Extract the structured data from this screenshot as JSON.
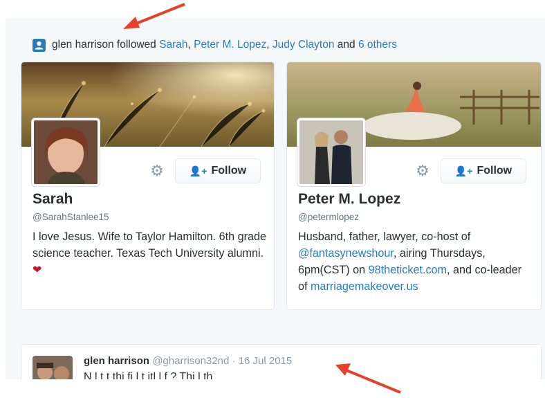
{
  "notice": {
    "actor": "glen harrison",
    "verb": "followed",
    "followed": [
      "Sarah",
      "Peter M. Lopez",
      "Judy Clayton"
    ],
    "and_text": "and",
    "others_link": "6 others"
  },
  "cards": [
    {
      "name": "Sarah",
      "handle": "@SarahStanlee15",
      "follow_label": "Follow",
      "bio": "I love Jesus. Wife to Taylor Hamilton. 6th grade science teacher. Texas Tech University alumni.",
      "bio_emoji": "❤"
    },
    {
      "name": "Peter M. Lopez",
      "handle": "@petermlopez",
      "follow_label": "Follow",
      "bio_parts": {
        "p1": "Husband, father, lawyer, co-host of ",
        "link1": "@fantasynewshour",
        "p2": ", airing Thursdays, 6pm(CST) on ",
        "link2": "98theticket.com",
        "p3": ", and co-leader of ",
        "link3": "marriagemakeover.us"
      }
    }
  ],
  "tweet": {
    "name": "glen harrison",
    "handle": "@gharrison32nd",
    "separator": "·",
    "date": "16 Jul 2015",
    "text_partial": "N      l   t     t        thi       fi    l   t  itl  l          f            ?  Thi   l   th"
  },
  "colors": {
    "link": "#2b7bb9",
    "annotation_arrow": "#e8402a",
    "panel_bg": "#f5f8fa",
    "heart": "#c0182c"
  },
  "icons": [
    "person-icon",
    "gear-icon",
    "add-person-icon",
    "heart-icon",
    "annotation-arrow"
  ]
}
